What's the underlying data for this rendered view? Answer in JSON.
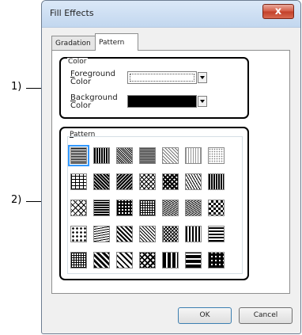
{
  "dialog": {
    "title": "Fill Effects",
    "close_label": "x"
  },
  "tabs": [
    {
      "label": "Gradation"
    },
    {
      "label": "Pattern",
      "selected": true
    }
  ],
  "color_group": {
    "title": "Color",
    "foreground": {
      "line1": "Foreground",
      "line2": "Color",
      "value": "#ffffff"
    },
    "background": {
      "line1": "Background",
      "line2": "Color",
      "value": "#000000"
    }
  },
  "pattern_group": {
    "title": "Pattern",
    "rows": 5,
    "cols": 7,
    "selected_index": 0
  },
  "callouts": {
    "one": "1)",
    "two": "2)"
  },
  "buttons": {
    "ok": "OK",
    "cancel": "Cancel"
  }
}
